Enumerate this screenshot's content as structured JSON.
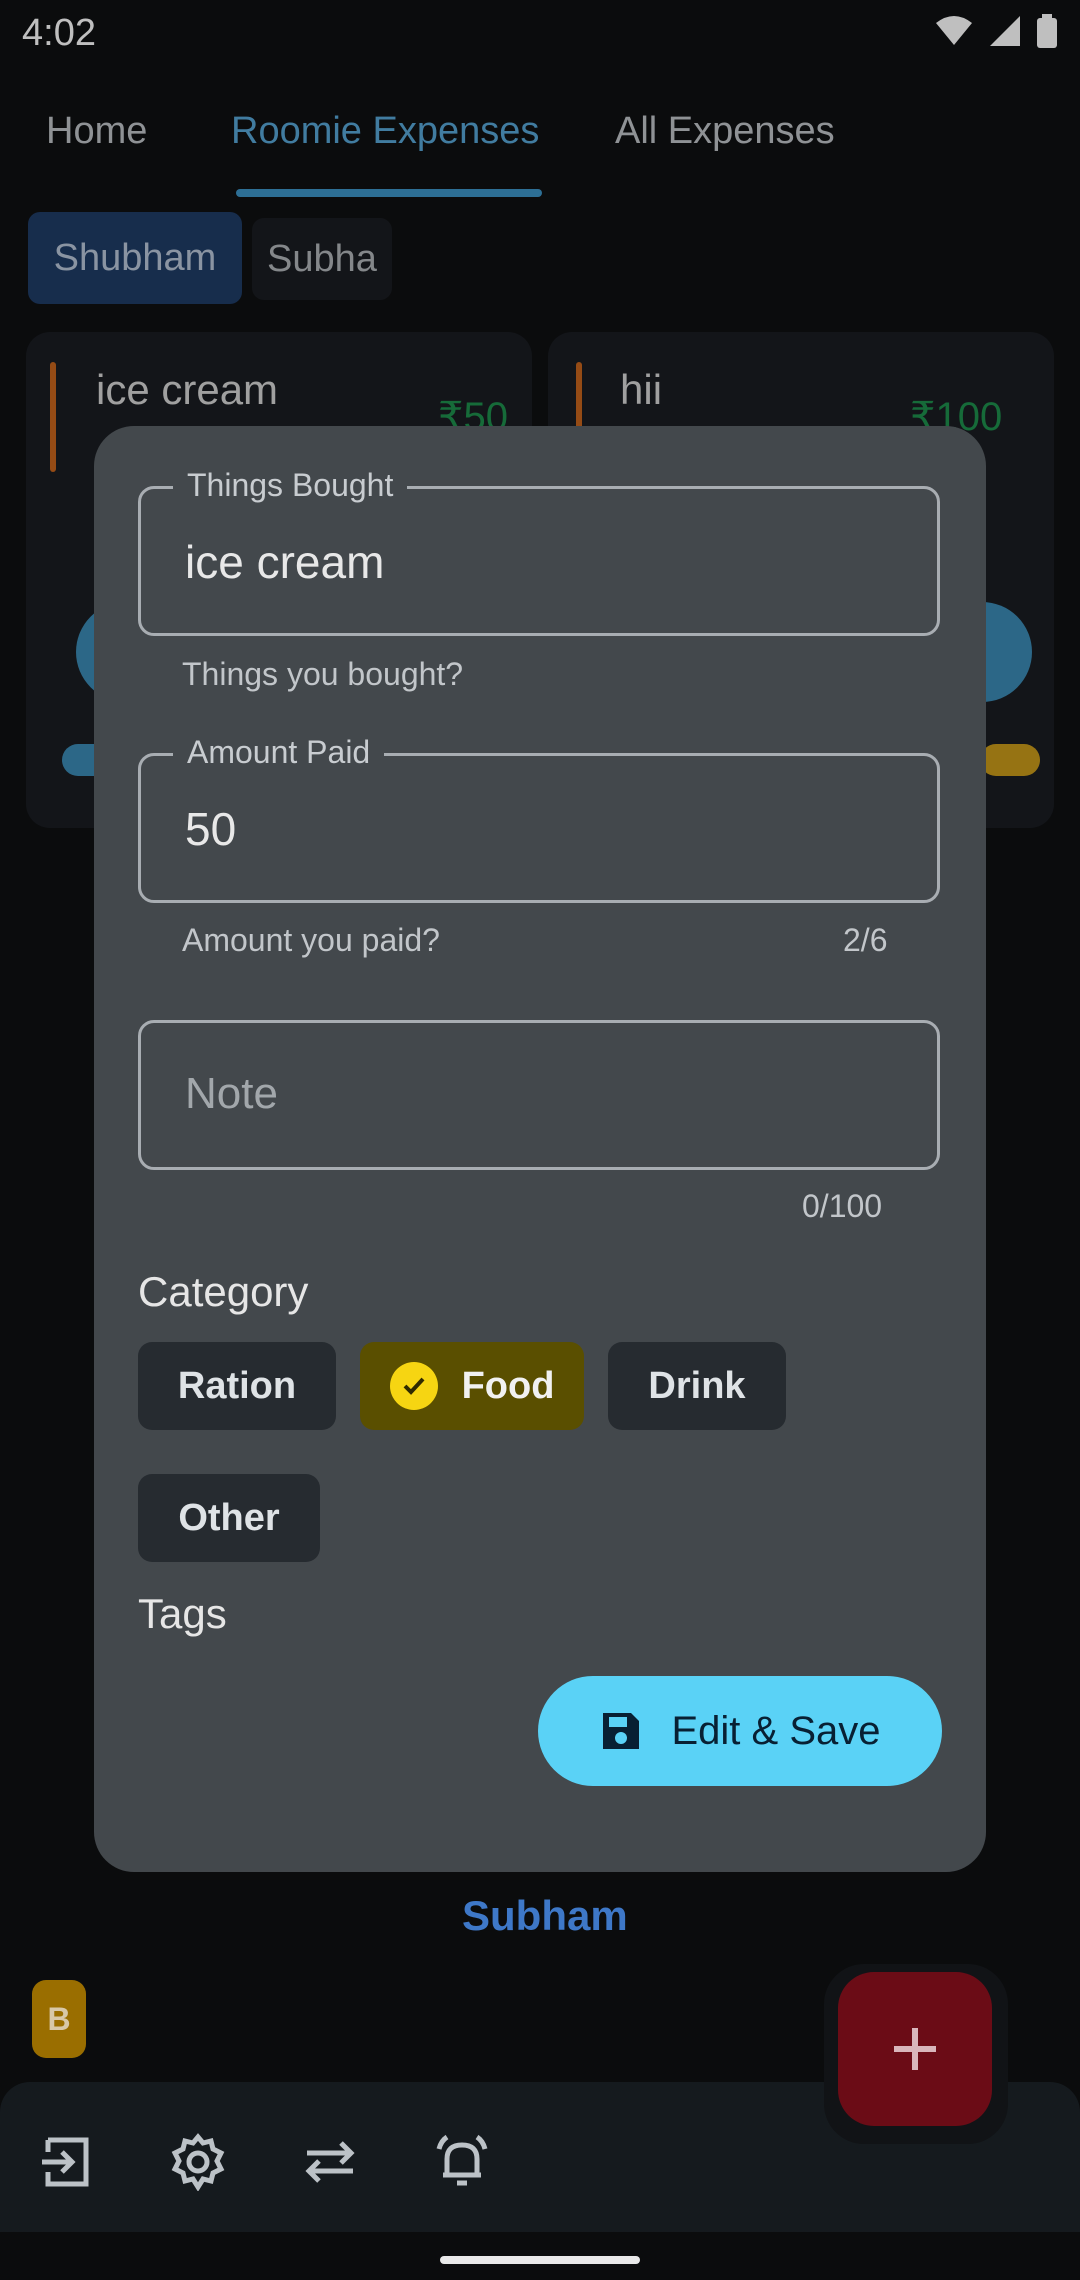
{
  "status_bar": {
    "time": "4:02"
  },
  "tabs": [
    {
      "label": "Home"
    },
    {
      "label": "Roomie Expenses"
    },
    {
      "label": "All Expenses"
    }
  ],
  "people": [
    {
      "label": "Shubham"
    },
    {
      "label": "Subha"
    }
  ],
  "background_cards": [
    {
      "name": "ice cream",
      "amount": "₹50"
    },
    {
      "name": "hii",
      "amount": "₹100"
    }
  ],
  "dialog": {
    "things_bought": {
      "label": "Things Bought",
      "value": "ice cream",
      "helper": "Things you bought?"
    },
    "amount_paid": {
      "label": "Amount Paid",
      "value": "50",
      "helper": "Amount you paid?",
      "counter": "2/6"
    },
    "note": {
      "placeholder": "Note",
      "counter": "0/100"
    },
    "category_title": "Category",
    "categories": [
      {
        "label": "Ration"
      },
      {
        "label": "Food"
      },
      {
        "label": "Drink"
      },
      {
        "label": "Other"
      }
    ],
    "tags_title": "Tags",
    "save_label": "Edit & Save"
  },
  "owner_label": "Subham",
  "badge_letter": "B",
  "colors": {
    "accent_tab": "#57a6d6",
    "save_button": "#5ad2f6",
    "selected_chip": "#5a4f00",
    "fab": "#6b0c16"
  }
}
